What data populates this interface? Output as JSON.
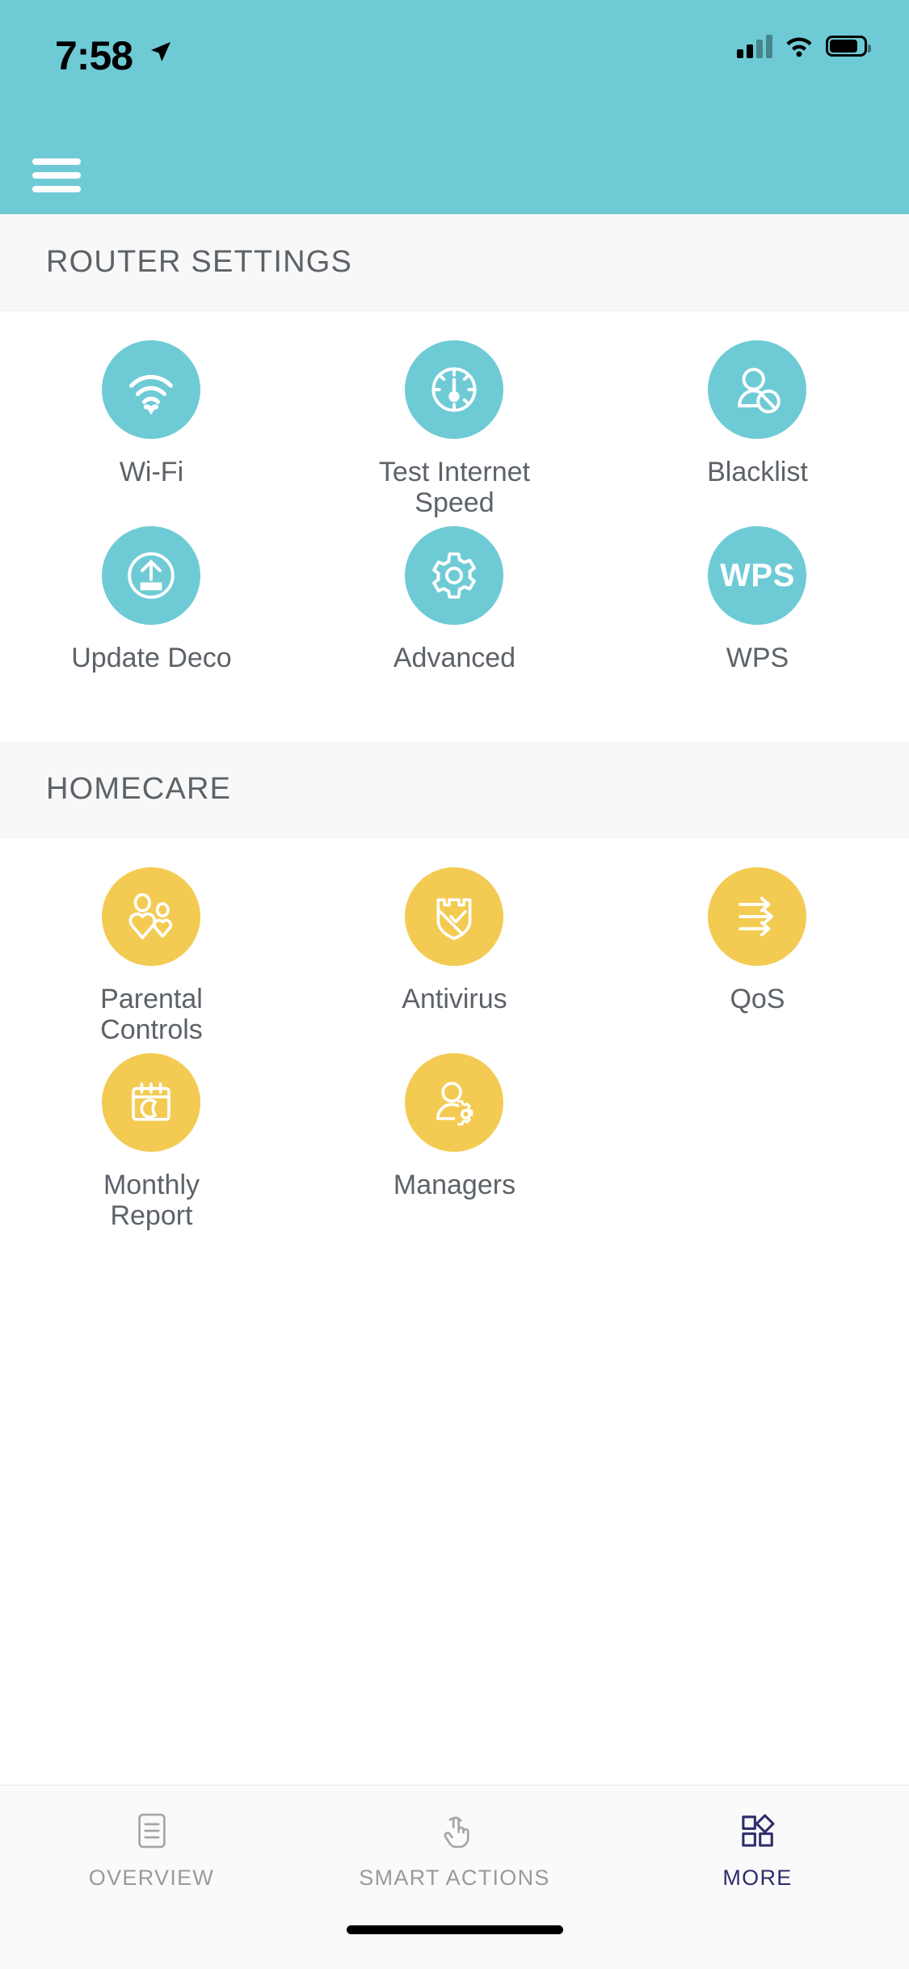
{
  "status_bar": {
    "time": "7:58",
    "location_icon": "location-arrow-icon",
    "cellular_icon": "cellular-signal-icon",
    "wifi_icon": "wifi-icon",
    "battery_icon": "battery-icon"
  },
  "app_bar": {
    "menu_icon": "hamburger-menu-icon"
  },
  "colors": {
    "header_teal": "#6ecbd6",
    "router_accent": "#6ecbd6",
    "homecare_accent": "#f3cb52",
    "label_gray": "#5c6268",
    "active_tab": "#2d2d6b",
    "section_bg": "#f8f8f8"
  },
  "sections": [
    {
      "id": "router-settings",
      "title": "ROUTER SETTINGS",
      "accent": "teal",
      "tiles": [
        {
          "label": "Wi-Fi",
          "icon": "wifi-icon"
        },
        {
          "label": "Test Internet Speed",
          "icon": "speedometer-icon"
        },
        {
          "label": "Blacklist",
          "icon": "user-blocked-icon"
        },
        {
          "label": "Update Deco",
          "icon": "upload-update-icon"
        },
        {
          "label": "Advanced",
          "icon": "gear-icon"
        },
        {
          "label": "WPS",
          "icon": "wps-text-icon",
          "icon_text": "WPS"
        }
      ]
    },
    {
      "id": "homecare",
      "title": "HOMECARE",
      "accent": "yellow",
      "tiles": [
        {
          "label": "Parental Controls",
          "icon": "family-hearts-icon"
        },
        {
          "label": "Antivirus",
          "icon": "shield-check-icon"
        },
        {
          "label": "QoS",
          "icon": "three-arrows-icon"
        },
        {
          "label": "Monthly Report",
          "icon": "calendar-moon-icon"
        },
        {
          "label": "Managers",
          "icon": "user-gear-icon"
        }
      ]
    }
  ],
  "tab_bar": {
    "tabs": [
      {
        "label": "OVERVIEW",
        "icon": "document-list-icon",
        "active": false
      },
      {
        "label": "SMART ACTIONS",
        "icon": "hand-tap-icon",
        "active": false
      },
      {
        "label": "MORE",
        "icon": "grid-diamond-icon",
        "active": true
      }
    ]
  }
}
